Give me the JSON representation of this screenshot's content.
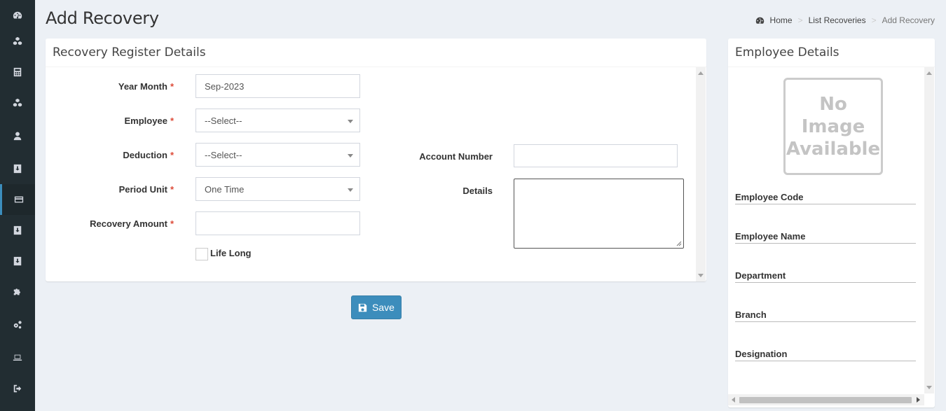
{
  "colors": {
    "sidebar": "#222d32",
    "accent": "#3c8dbc",
    "required": "#dd4b39",
    "background": "#ecf0f5"
  },
  "sidebar": {
    "items": [
      {
        "icon": "dashboard-icon"
      },
      {
        "icon": "cubes-icon"
      },
      {
        "icon": "calculator-icon"
      },
      {
        "icon": "cubes-icon"
      },
      {
        "icon": "user-icon"
      },
      {
        "icon": "download-icon"
      },
      {
        "icon": "credit-card-icon",
        "active": true
      },
      {
        "icon": "download-icon"
      },
      {
        "icon": "download-icon"
      },
      {
        "icon": "puzzle-icon"
      },
      {
        "icon": "cogs-icon"
      },
      {
        "icon": "laptop-icon"
      },
      {
        "icon": "sign-out-icon"
      }
    ]
  },
  "page": {
    "title": "Add Recovery"
  },
  "breadcrumb": {
    "home": "Home",
    "list": "List Recoveries",
    "current": "Add Recovery"
  },
  "register": {
    "title": "Recovery Register Details",
    "year_month": {
      "label": "Year Month",
      "value": "Sep-2023"
    },
    "employee": {
      "label": "Employee",
      "value": "--Select--"
    },
    "deduction": {
      "label": "Deduction",
      "value": "--Select--"
    },
    "period_unit": {
      "label": "Period Unit",
      "value": "One Time"
    },
    "recovery_amount": {
      "label": "Recovery Amount",
      "value": ""
    },
    "life_long": {
      "label": "Life Long",
      "checked": false
    },
    "account_number": {
      "label": "Account Number",
      "value": ""
    },
    "details": {
      "label": "Details",
      "value": ""
    },
    "required_mark": "*"
  },
  "actions": {
    "save_label": "Save"
  },
  "employee_details": {
    "title": "Employee Details",
    "no_image": [
      "No",
      "Image",
      "Available"
    ],
    "fields": [
      "Employee Code",
      "Employee Name",
      "Department",
      "Branch",
      "Designation"
    ]
  }
}
